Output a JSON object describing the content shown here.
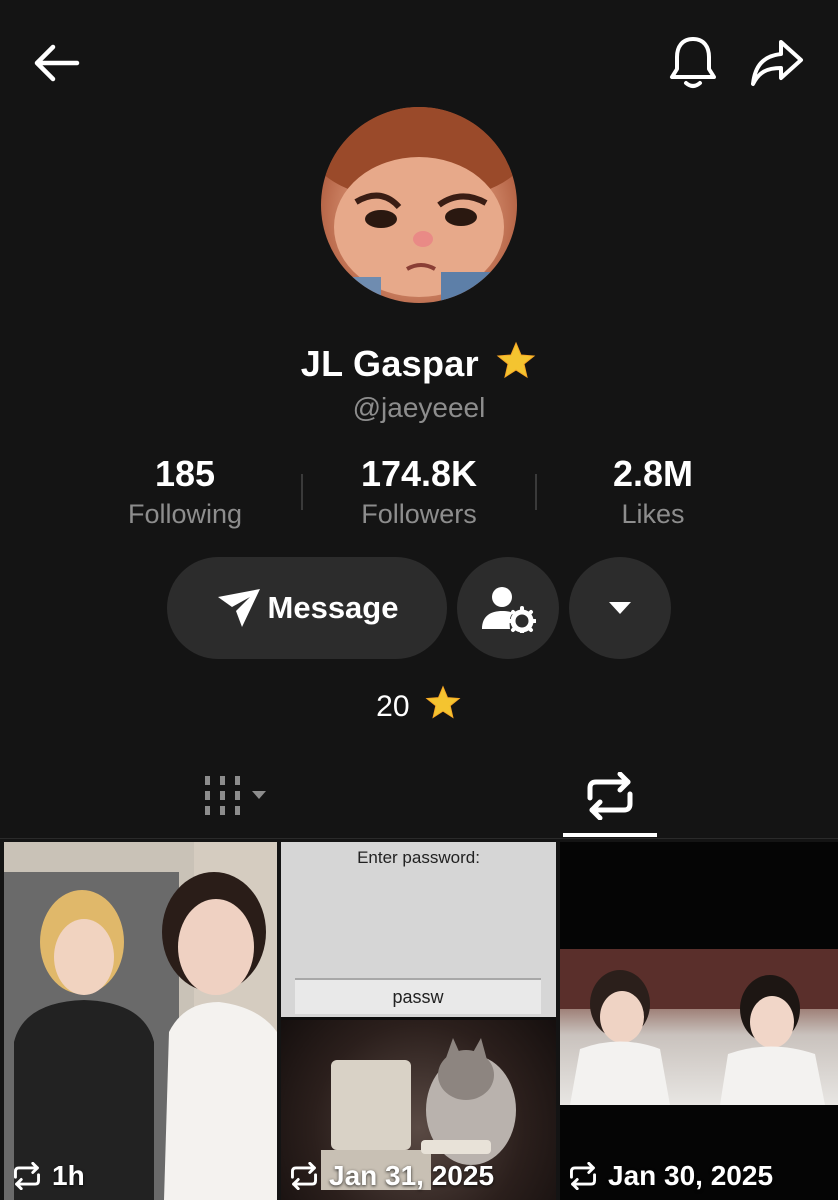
{
  "profile": {
    "display_name": "JL Gaspar",
    "handle": "@jaeyeeel",
    "star_count": "20"
  },
  "stats": [
    {
      "value": "185",
      "label": "Following"
    },
    {
      "value": "174.8K",
      "label": "Followers"
    },
    {
      "value": "2.8M",
      "label": "Likes"
    }
  ],
  "actions": {
    "message_label": "Message"
  },
  "posts": [
    {
      "time": "1h"
    },
    {
      "time": "Jan 31, 2025",
      "screen_title": "Enter password:",
      "screen_input": "passw"
    },
    {
      "time": "Jan 30, 2025"
    }
  ],
  "icons": {
    "back": "arrow-left-icon",
    "notifications": "bell-icon",
    "share": "share-icon",
    "message": "send-icon",
    "user_settings": "user-gear-icon",
    "more": "caret-down-icon",
    "grid_tab": "grid-icon",
    "reposts_tab": "repost-icon",
    "star": "star-icon"
  },
  "colors": {
    "background": "#141414",
    "button": "#2c2c2c",
    "muted_text": "#8d8d8d",
    "star": "#f4c430"
  }
}
